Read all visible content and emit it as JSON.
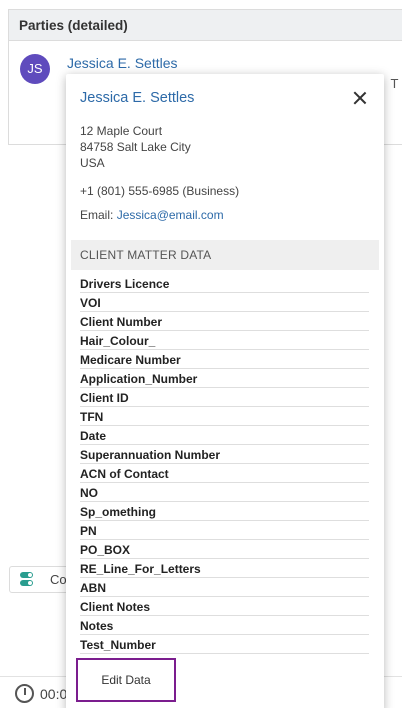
{
  "background": {
    "panel_title": "Parties (detailed)",
    "avatar_initials": "JS",
    "party_name": "Jessica E. Settles",
    "truncated_text": "T 8",
    "toggle_label": "Co",
    "timer_text": "00:0"
  },
  "popover": {
    "name": "Jessica E. Settles",
    "address_line1": "12 Maple Court",
    "address_line2": "84758 Salt Lake City",
    "address_line3": "USA",
    "phone": "+1 (801) 555-6985 (Business)",
    "email_label": "Email: ",
    "email": "Jessica@email.com",
    "section_title": "CLIENT MATTER DATA",
    "fields": [
      "Drivers Licence",
      "VOI",
      "Client Number",
      "Hair_Colour_",
      "Medicare Number",
      "Application_Number",
      "Client ID",
      "TFN",
      "Date",
      "Superannuation Number",
      "ACN of Contact",
      "NO",
      "Sp_omething",
      "PN",
      "PO_BOX",
      "RE_Line_For_Letters",
      "ABN",
      "Client Notes",
      "Notes",
      "Test_Number"
    ],
    "edit_button": "Edit Data"
  }
}
